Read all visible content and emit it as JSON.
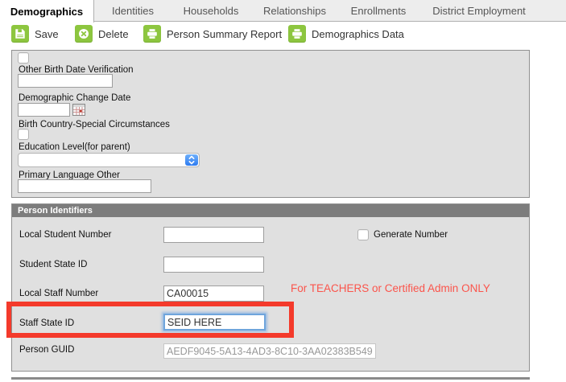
{
  "colors": {
    "accent_green": "#8dc63f",
    "section_header_bg": "#7d7d7d",
    "section_bg": "#e0e0e0",
    "note_red": "#fb544b",
    "highlight_red": "#f43a2b",
    "focus_blue": "#6fa5dc",
    "select_blue": "#2e7bf0"
  },
  "tabs": {
    "items": [
      {
        "label": "Demographics",
        "active": true
      },
      {
        "label": "Identities",
        "active": false
      },
      {
        "label": "Households",
        "active": false
      },
      {
        "label": "Relationships",
        "active": false
      },
      {
        "label": "Enrollments",
        "active": false
      },
      {
        "label": "District Employment",
        "active": false
      }
    ]
  },
  "toolbar": {
    "save_label": "Save",
    "delete_label": "Delete",
    "person_summary_report_label": "Person Summary Report",
    "demographics_data_label": "Demographics Data"
  },
  "demographics_form": {
    "other_birth_date_verification": {
      "label": "Other Birth Date Verification",
      "value": ""
    },
    "demographic_change_date": {
      "label": "Demographic Change Date",
      "value": ""
    },
    "birth_country_special_circumstances": {
      "label": "Birth Country-Special Circumstances"
    },
    "education_level": {
      "label": "Education Level(for parent)",
      "selected": ""
    },
    "primary_language_other": {
      "label": "Primary Language Other",
      "value": ""
    }
  },
  "person_identifiers": {
    "title": "Person Identifiers",
    "local_student_number": {
      "label": "Local Student Number",
      "value": ""
    },
    "generate_number": {
      "label": "Generate Number"
    },
    "student_state_id": {
      "label": "Student State ID",
      "value": ""
    },
    "local_staff_number": {
      "label": "Local Staff Number",
      "value": "CA00015"
    },
    "staff_state_id": {
      "label": "Staff State ID",
      "value": "SEID HERE"
    },
    "person_guid": {
      "label": "Person GUID",
      "value": "AEDF9045-5A13-4AD3-8C10-3AA02383B549"
    },
    "annotation_note": "For TEACHERS or Certified Admin ONLY"
  }
}
